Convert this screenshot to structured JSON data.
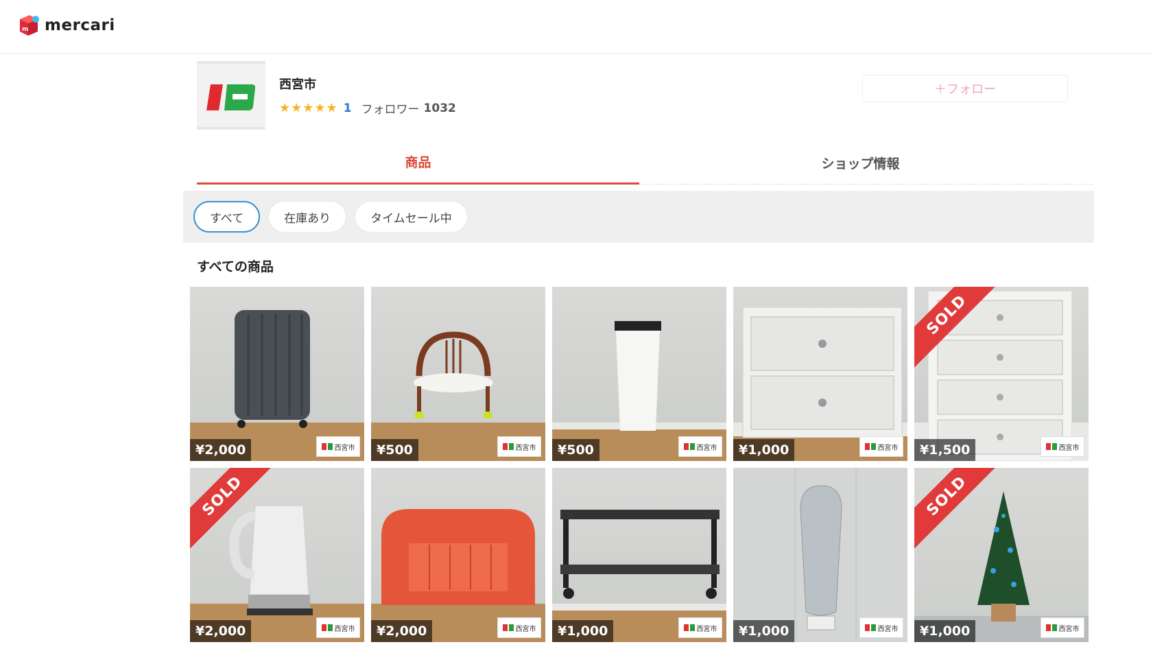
{
  "header": {
    "logo_text": "mercari",
    "logo_icon": "mercari-box-icon"
  },
  "shop": {
    "name": "西宮市",
    "stars": "★★★★★",
    "rating_count": "1",
    "followers_label": "フォロワー",
    "followers_count": "1032",
    "follow_button": "＋フォロー"
  },
  "tabs": [
    {
      "label": "商品",
      "active": true
    },
    {
      "label": "ショップ情報",
      "active": false
    }
  ],
  "filters": [
    {
      "label": "すべて",
      "active": true
    },
    {
      "label": "在庫あり",
      "active": false
    },
    {
      "label": "タイムセール中",
      "active": false
    }
  ],
  "section_title": "すべての商品",
  "products": [
    {
      "price": "¥2,000",
      "sold": false,
      "item": "suitcase"
    },
    {
      "price": "¥500",
      "sold": false,
      "item": "child-chair"
    },
    {
      "price": "¥500",
      "sold": false,
      "item": "trash-can"
    },
    {
      "price": "¥1,000",
      "sold": false,
      "item": "drawer-chest"
    },
    {
      "price": "¥1,500",
      "sold": true,
      "item": "tall-drawers"
    },
    {
      "price": "¥2,000",
      "sold": true,
      "item": "kettle"
    },
    {
      "price": "¥2,000",
      "sold": false,
      "item": "floor-sofa"
    },
    {
      "price": "¥1,000",
      "sold": false,
      "item": "tv-stand"
    },
    {
      "price": "¥1,000",
      "sold": false,
      "item": "ironing-board"
    },
    {
      "price": "¥1,000",
      "sold": true,
      "item": "christmas-tree"
    }
  ],
  "sold_label": "SOLD",
  "watermark_text": "西宮市",
  "colors": {
    "accent": "#d84a39",
    "sold_ribbon": "#e03a3a",
    "active_chip_border": "#3b8fcf",
    "star": "#f5b324"
  }
}
